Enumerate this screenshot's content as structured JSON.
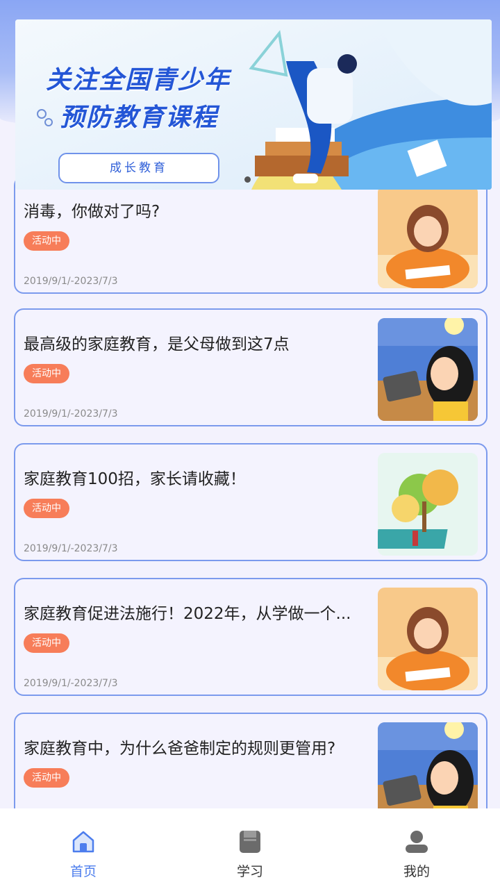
{
  "banner": {
    "line1": "关注全国青少年",
    "line2": "预防教育课程",
    "button_label": "成长教育"
  },
  "articles": [
    {
      "title": "消毒，你做对了吗?",
      "badge": "活动中",
      "date": "2019/9/1/-2023/7/3",
      "thumb": "girl-writing"
    },
    {
      "title": "最高级的家庭教育，是父母做到这7点",
      "badge": "活动中",
      "date": "2019/9/1/-2023/7/3",
      "thumb": "girl-laptop"
    },
    {
      "title": "家庭教育100招，家长请收藏！",
      "badge": "活动中",
      "date": "2019/9/1/-2023/7/3",
      "thumb": "tree-book"
    },
    {
      "title": "家庭教育促进法施行！2022年，从学做一个...",
      "badge": "活动中",
      "date": "2019/9/1/-2023/7/3",
      "thumb": "girl-writing"
    },
    {
      "title": "家庭教育中，为什么爸爸制定的规则更管用?",
      "badge": "活动中",
      "date": "",
      "thumb": "girl-laptop"
    }
  ],
  "tabbar": {
    "home": "首页",
    "study": "学习",
    "mine": "我的"
  },
  "colors": {
    "accent": "#4c7ded",
    "badge": "#f77d59",
    "card_border": "#7b9aed"
  }
}
